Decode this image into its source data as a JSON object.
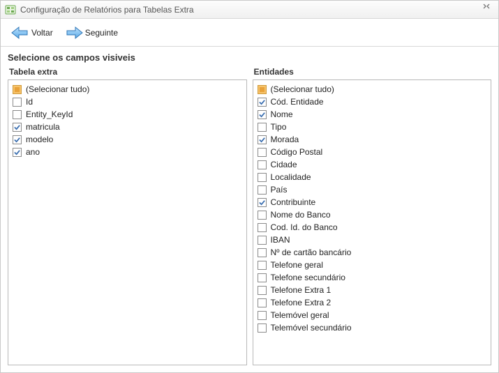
{
  "window": {
    "title": "Configuração de Relatórios para Tabelas Extra"
  },
  "toolbar": {
    "back_label": "Voltar",
    "next_label": "Seguinte"
  },
  "section_title": "Selecione os campos visiveis",
  "left": {
    "header": "Tabela extra",
    "select_all_label": "(Selecionar tudo)",
    "select_all_state": "indeterminate",
    "items": [
      {
        "label": "Id",
        "checked": false
      },
      {
        "label": "Entity_KeyId",
        "checked": false
      },
      {
        "label": "matricula",
        "checked": true
      },
      {
        "label": "modelo",
        "checked": true
      },
      {
        "label": "ano",
        "checked": true
      }
    ]
  },
  "right": {
    "header": "Entidades",
    "select_all_label": "(Selecionar tudo)",
    "select_all_state": "indeterminate",
    "items": [
      {
        "label": "Cód. Entidade",
        "checked": true
      },
      {
        "label": "Nome",
        "checked": true
      },
      {
        "label": "Tipo",
        "checked": false
      },
      {
        "label": "Morada",
        "checked": true
      },
      {
        "label": "Código Postal",
        "checked": false
      },
      {
        "label": "Cidade",
        "checked": false
      },
      {
        "label": "Localidade",
        "checked": false
      },
      {
        "label": "País",
        "checked": false
      },
      {
        "label": "Contribuinte",
        "checked": true
      },
      {
        "label": "Nome do Banco",
        "checked": false
      },
      {
        "label": "Cod. Id. do Banco",
        "checked": false
      },
      {
        "label": "IBAN",
        "checked": false
      },
      {
        "label": "Nº de cartão bancário",
        "checked": false
      },
      {
        "label": "Telefone geral",
        "checked": false
      },
      {
        "label": "Telefone secundário",
        "checked": false
      },
      {
        "label": "Telefone Extra 1",
        "checked": false
      },
      {
        "label": "Telefone Extra 2",
        "checked": false
      },
      {
        "label": "Telemóvel geral",
        "checked": false
      },
      {
        "label": "Telemóvel secundário",
        "checked": false
      }
    ]
  }
}
